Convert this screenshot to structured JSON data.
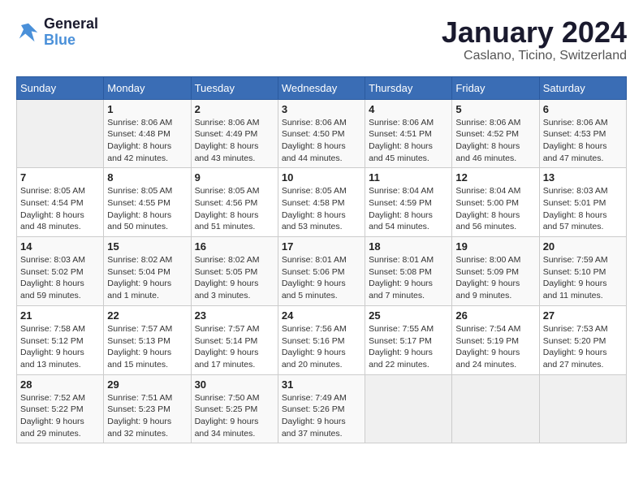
{
  "logo": {
    "line1": "General",
    "line2": "Blue"
  },
  "title": "January 2024",
  "location": "Caslano, Ticino, Switzerland",
  "weekdays": [
    "Sunday",
    "Monday",
    "Tuesday",
    "Wednesday",
    "Thursday",
    "Friday",
    "Saturday"
  ],
  "weeks": [
    [
      {
        "day": "",
        "info": ""
      },
      {
        "day": "1",
        "info": "Sunrise: 8:06 AM\nSunset: 4:48 PM\nDaylight: 8 hours\nand 42 minutes."
      },
      {
        "day": "2",
        "info": "Sunrise: 8:06 AM\nSunset: 4:49 PM\nDaylight: 8 hours\nand 43 minutes."
      },
      {
        "day": "3",
        "info": "Sunrise: 8:06 AM\nSunset: 4:50 PM\nDaylight: 8 hours\nand 44 minutes."
      },
      {
        "day": "4",
        "info": "Sunrise: 8:06 AM\nSunset: 4:51 PM\nDaylight: 8 hours\nand 45 minutes."
      },
      {
        "day": "5",
        "info": "Sunrise: 8:06 AM\nSunset: 4:52 PM\nDaylight: 8 hours\nand 46 minutes."
      },
      {
        "day": "6",
        "info": "Sunrise: 8:06 AM\nSunset: 4:53 PM\nDaylight: 8 hours\nand 47 minutes."
      }
    ],
    [
      {
        "day": "7",
        "info": "Sunrise: 8:05 AM\nSunset: 4:54 PM\nDaylight: 8 hours\nand 48 minutes."
      },
      {
        "day": "8",
        "info": "Sunrise: 8:05 AM\nSunset: 4:55 PM\nDaylight: 8 hours\nand 50 minutes."
      },
      {
        "day": "9",
        "info": "Sunrise: 8:05 AM\nSunset: 4:56 PM\nDaylight: 8 hours\nand 51 minutes."
      },
      {
        "day": "10",
        "info": "Sunrise: 8:05 AM\nSunset: 4:58 PM\nDaylight: 8 hours\nand 53 minutes."
      },
      {
        "day": "11",
        "info": "Sunrise: 8:04 AM\nSunset: 4:59 PM\nDaylight: 8 hours\nand 54 minutes."
      },
      {
        "day": "12",
        "info": "Sunrise: 8:04 AM\nSunset: 5:00 PM\nDaylight: 8 hours\nand 56 minutes."
      },
      {
        "day": "13",
        "info": "Sunrise: 8:03 AM\nSunset: 5:01 PM\nDaylight: 8 hours\nand 57 minutes."
      }
    ],
    [
      {
        "day": "14",
        "info": "Sunrise: 8:03 AM\nSunset: 5:02 PM\nDaylight: 8 hours\nand 59 minutes."
      },
      {
        "day": "15",
        "info": "Sunrise: 8:02 AM\nSunset: 5:04 PM\nDaylight: 9 hours\nand 1 minute."
      },
      {
        "day": "16",
        "info": "Sunrise: 8:02 AM\nSunset: 5:05 PM\nDaylight: 9 hours\nand 3 minutes."
      },
      {
        "day": "17",
        "info": "Sunrise: 8:01 AM\nSunset: 5:06 PM\nDaylight: 9 hours\nand 5 minutes."
      },
      {
        "day": "18",
        "info": "Sunrise: 8:01 AM\nSunset: 5:08 PM\nDaylight: 9 hours\nand 7 minutes."
      },
      {
        "day": "19",
        "info": "Sunrise: 8:00 AM\nSunset: 5:09 PM\nDaylight: 9 hours\nand 9 minutes."
      },
      {
        "day": "20",
        "info": "Sunrise: 7:59 AM\nSunset: 5:10 PM\nDaylight: 9 hours\nand 11 minutes."
      }
    ],
    [
      {
        "day": "21",
        "info": "Sunrise: 7:58 AM\nSunset: 5:12 PM\nDaylight: 9 hours\nand 13 minutes."
      },
      {
        "day": "22",
        "info": "Sunrise: 7:57 AM\nSunset: 5:13 PM\nDaylight: 9 hours\nand 15 minutes."
      },
      {
        "day": "23",
        "info": "Sunrise: 7:57 AM\nSunset: 5:14 PM\nDaylight: 9 hours\nand 17 minutes."
      },
      {
        "day": "24",
        "info": "Sunrise: 7:56 AM\nSunset: 5:16 PM\nDaylight: 9 hours\nand 20 minutes."
      },
      {
        "day": "25",
        "info": "Sunrise: 7:55 AM\nSunset: 5:17 PM\nDaylight: 9 hours\nand 22 minutes."
      },
      {
        "day": "26",
        "info": "Sunrise: 7:54 AM\nSunset: 5:19 PM\nDaylight: 9 hours\nand 24 minutes."
      },
      {
        "day": "27",
        "info": "Sunrise: 7:53 AM\nSunset: 5:20 PM\nDaylight: 9 hours\nand 27 minutes."
      }
    ],
    [
      {
        "day": "28",
        "info": "Sunrise: 7:52 AM\nSunset: 5:22 PM\nDaylight: 9 hours\nand 29 minutes."
      },
      {
        "day": "29",
        "info": "Sunrise: 7:51 AM\nSunset: 5:23 PM\nDaylight: 9 hours\nand 32 minutes."
      },
      {
        "day": "30",
        "info": "Sunrise: 7:50 AM\nSunset: 5:25 PM\nDaylight: 9 hours\nand 34 minutes."
      },
      {
        "day": "31",
        "info": "Sunrise: 7:49 AM\nSunset: 5:26 PM\nDaylight: 9 hours\nand 37 minutes."
      },
      {
        "day": "",
        "info": ""
      },
      {
        "day": "",
        "info": ""
      },
      {
        "day": "",
        "info": ""
      }
    ]
  ]
}
